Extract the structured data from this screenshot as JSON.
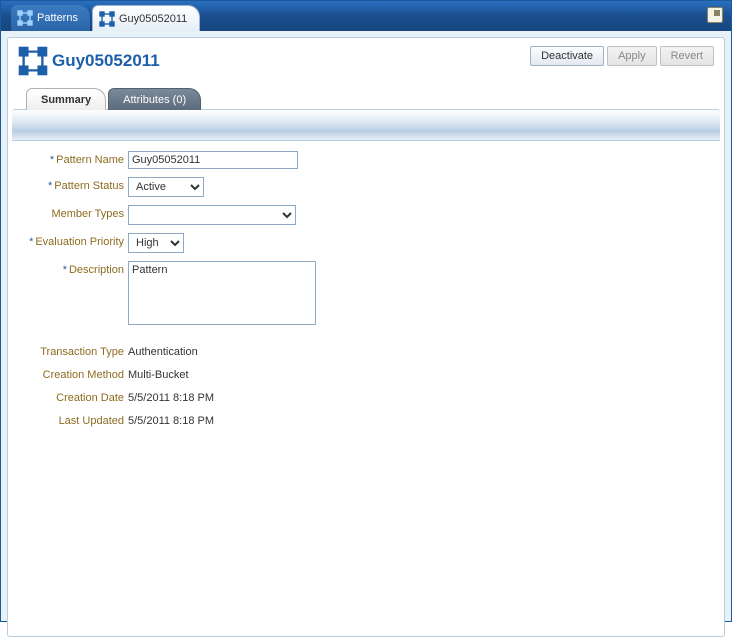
{
  "tabs": {
    "patterns_label": "Patterns",
    "current_label": "Guy05052011"
  },
  "title": "Guy05052011",
  "buttons": {
    "deactivate": "Deactivate",
    "apply": "Apply",
    "revert": "Revert"
  },
  "innerTabs": {
    "summary": "Summary",
    "attributes": "Attributes (0)"
  },
  "labels": {
    "pattern_name": "Pattern Name",
    "pattern_status": "Pattern Status",
    "member_types": "Member Types",
    "evaluation_priority": "Evaluation Priority",
    "description": "Description",
    "transaction_type": "Transaction Type",
    "creation_method": "Creation Method",
    "creation_date": "Creation Date",
    "last_updated": "Last Updated"
  },
  "values": {
    "pattern_name": "Guy05052011",
    "pattern_status": "Active",
    "member_types": "",
    "evaluation_priority": "High",
    "description": "Pattern",
    "transaction_type": "Authentication",
    "creation_method": "Multi-Bucket",
    "creation_date": "5/5/2011 8:18 PM",
    "last_updated": "5/5/2011 8:18 PM"
  },
  "required_marker": "*"
}
